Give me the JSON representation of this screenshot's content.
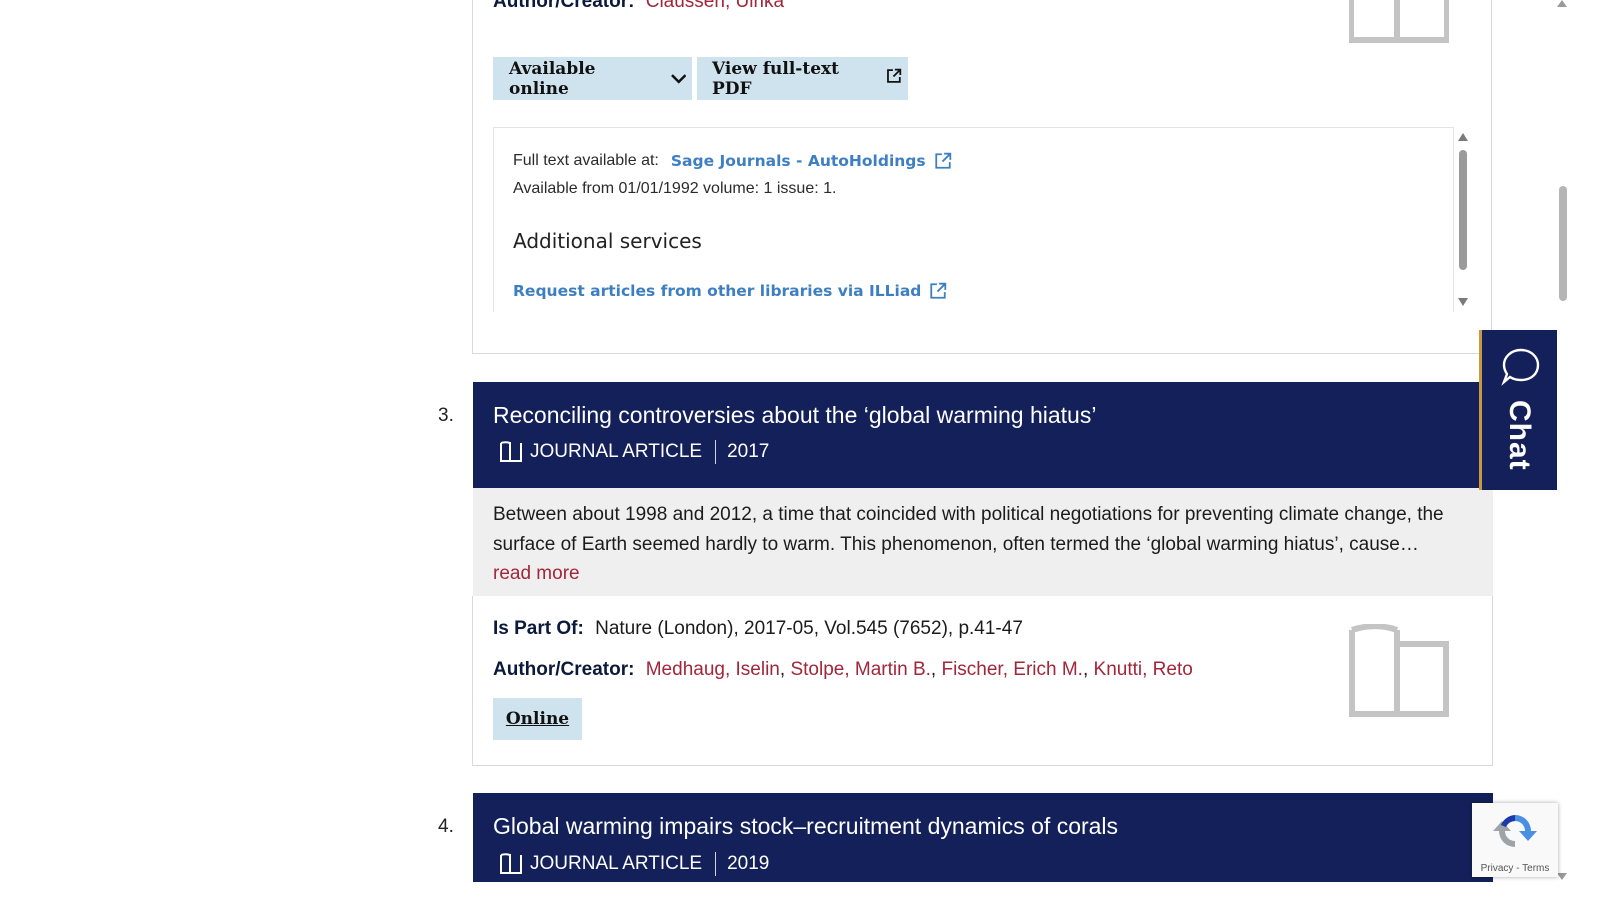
{
  "result2": {
    "author_label": "Author/Creator:",
    "author_name": "Claussen, Ulrika",
    "available_button": "Available online",
    "pdf_button": "View full-text PDF",
    "fulltext_label": "Full text available at:",
    "provider_link": "Sage Journals - AutoHoldings",
    "availability_detail": "Available from 01/01/1992 volume: 1 issue: 1.",
    "additional_heading": "Additional services",
    "illiad_link": "Request articles from other libraries via ILLiad"
  },
  "result3": {
    "number": "3.",
    "title": "Reconciling controversies about the ‘global warming hiatus’",
    "type": "JOURNAL ARTICLE",
    "year": "2017",
    "abstract": "Between about 1998 and 2012, a time that coincided with political negotiations for preventing climate change, the surface of Earth seemed hardly to warm. This phenomenon, often termed the ‘global warming hiatus’, cause…",
    "read_more": "read more",
    "part_of_label": "Is Part Of:",
    "part_of_value": "Nature (London), 2017-05, Vol.545 (7652), p.41-47",
    "author_label": "Author/Creator:",
    "authors": [
      "Medhaug, Iselin",
      "Stolpe, Martin B.",
      "Fischer, Erich M.",
      "Knutti, Reto"
    ],
    "authors_sep": ", ",
    "online_button": "Online"
  },
  "result4": {
    "number": "4.",
    "title": "Global warming impairs stock–recruitment dynamics of corals",
    "type": "JOURNAL ARTICLE",
    "year": "2019"
  },
  "chat": {
    "label": "Chat"
  },
  "recaptcha": {
    "text": "Privacy - Terms"
  },
  "colors": {
    "header_bg": "#13205a",
    "button_bg": "#cfe3ef",
    "link_blue": "#3d7fc2",
    "author_red": "#a2263a",
    "chat_border": "#c79a3e"
  },
  "icons": {
    "journal": "open-book-icon",
    "external": "external-link-icon",
    "chevron": "chevron-down-icon",
    "chat": "chat-bubble-icon",
    "recaptcha": "recaptcha-icon"
  }
}
